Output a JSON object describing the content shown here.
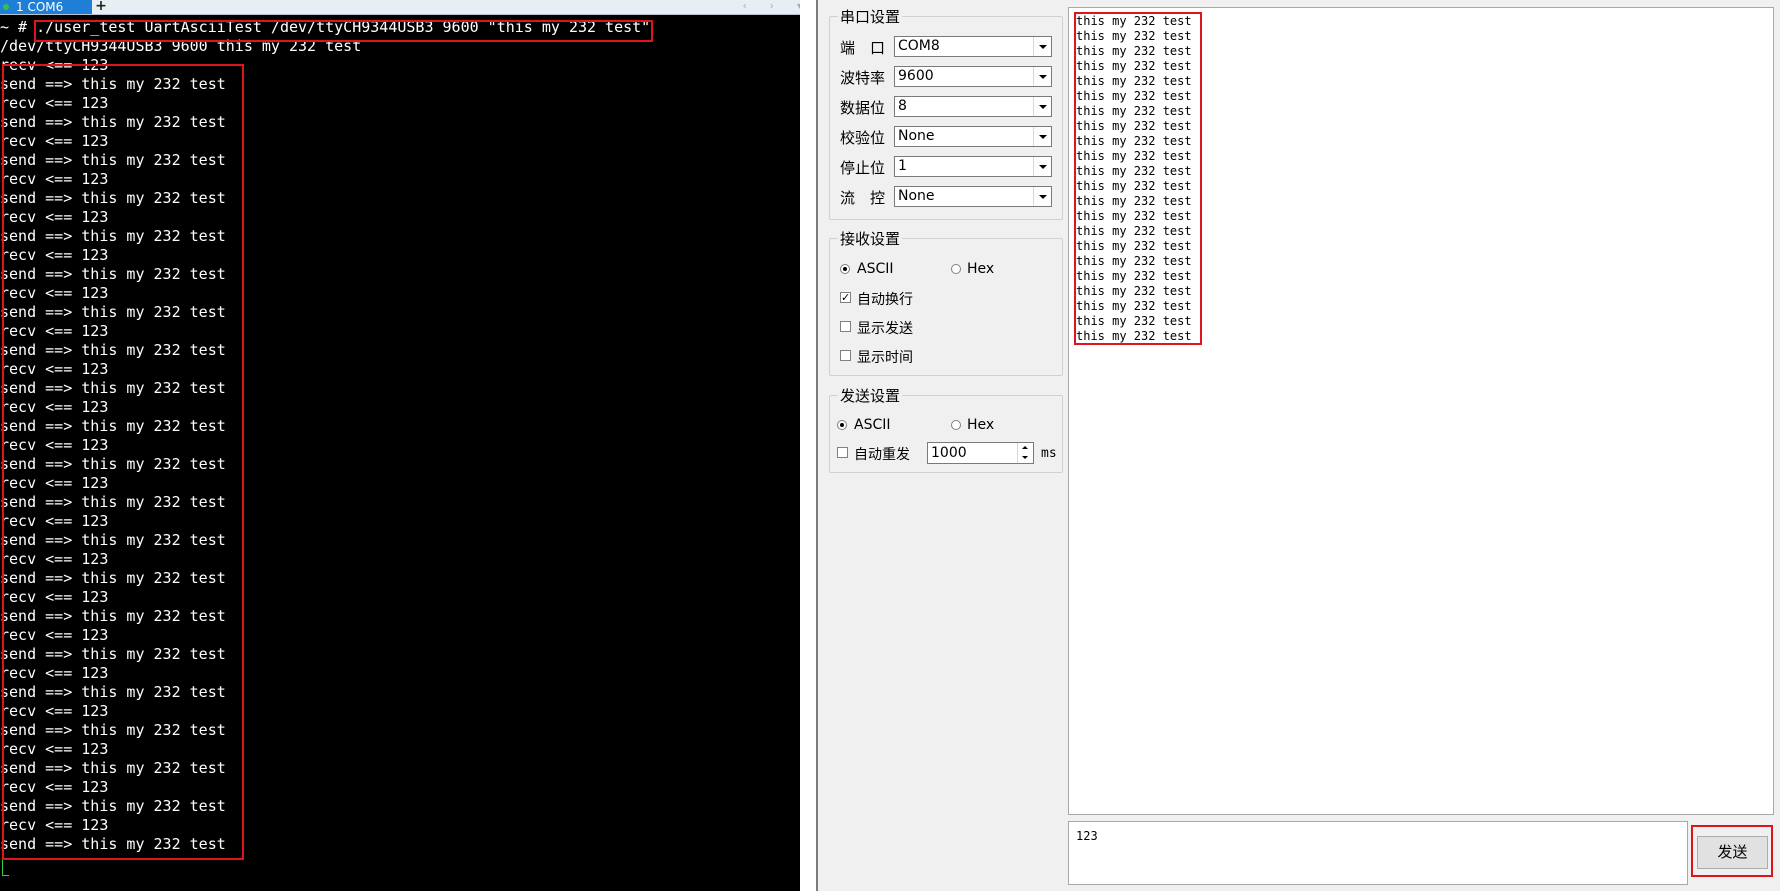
{
  "terminal": {
    "tab_label": "1 COM6",
    "tab_close": "×",
    "tab_add": "+",
    "tab_nav": "‹ › ▾",
    "lines": [
      "~ # ./user_test UartAsciiTest /dev/ttyCH9344USB3 9600 \"this my 232 test\"",
      "/dev/ttyCH9344USB3 9600 this my 232 test",
      "recv <== 123",
      "send ==> this my 232 test",
      "recv <== 123",
      "send ==> this my 232 test",
      "recv <== 123",
      "send ==> this my 232 test",
      "recv <== 123",
      "send ==> this my 232 test",
      "recv <== 123",
      "send ==> this my 232 test",
      "recv <== 123",
      "send ==> this my 232 test",
      "recv <== 123",
      "send ==> this my 232 test",
      "recv <== 123",
      "send ==> this my 232 test",
      "recv <== 123",
      "send ==> this my 232 test",
      "recv <== 123",
      "send ==> this my 232 test",
      "recv <== 123",
      "send ==> this my 232 test",
      "recv <== 123",
      "send ==> this my 232 test",
      "recv <== 123",
      "send ==> this my 232 test",
      "recv <== 123",
      "send ==> this my 232 test",
      "recv <== 123",
      "send ==> this my 232 test",
      "recv <== 123",
      "send ==> this my 232 test",
      "recv <== 123",
      "send ==> this my 232 test",
      "recv <== 123",
      "send ==> this my 232 test",
      "recv <== 123",
      "send ==> this my 232 test",
      "recv <== 123",
      "send ==> this my 232 test",
      "recv <== 123",
      "send ==> this my 232 test"
    ]
  },
  "serial_settings": {
    "title": "串口设置",
    "port_label": "端　口",
    "port_value": "COM8",
    "baud_label": "波特率",
    "baud_value": "9600",
    "databits_label": "数据位",
    "databits_value": "8",
    "parity_label": "校验位",
    "parity_value": "None",
    "stopbits_label": "停止位",
    "stopbits_value": "1",
    "flow_label": "流　控",
    "flow_value": "None"
  },
  "receive_settings": {
    "title": "接收设置",
    "ascii_label": "ASCII",
    "hex_label": "Hex",
    "auto_newline_label": "自动换行",
    "show_send_label": "显示发送",
    "show_time_label": "显示时间",
    "check_mark": "✓"
  },
  "send_settings": {
    "title": "发送设置",
    "ascii_label": "ASCII",
    "hex_label": "Hex",
    "auto_resend_label": "自动重发",
    "interval_value": "1000",
    "interval_unit": "ms"
  },
  "receive_area": {
    "line_text": "this my 232 test",
    "line_count": 22
  },
  "send_area": {
    "value": "123",
    "send_button": "发送"
  }
}
